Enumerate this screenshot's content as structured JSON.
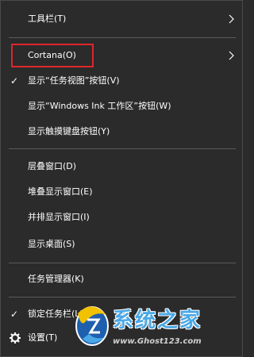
{
  "menu": {
    "items": [
      {
        "label": "工具栏(T)"
      },
      {
        "label": "Cortana(O)"
      },
      {
        "label": "显示“任务视图”按钮(V)",
        "check": "✓"
      },
      {
        "label": "显示“Windows Ink 工作区”按钮(W)"
      },
      {
        "label": "显示触摸键盘按钮(Y)"
      },
      {
        "label": "层叠窗口(D)"
      },
      {
        "label": "堆叠显示窗口(E)"
      },
      {
        "label": "并排显示窗口(I)"
      },
      {
        "label": "显示桌面(S)"
      },
      {
        "label": "任务管理器(K)"
      },
      {
        "label": "锁定任务栏(L)",
        "check": "✓"
      },
      {
        "label": "设置(T)",
        "icon": "gear-icon"
      }
    ]
  },
  "watermark": {
    "title": "系统之家",
    "url": "www.Ghost123.com"
  },
  "colors": {
    "menu_bg": "#2b2b2b",
    "highlight_border": "#e0262a",
    "text": "#ffffff"
  }
}
